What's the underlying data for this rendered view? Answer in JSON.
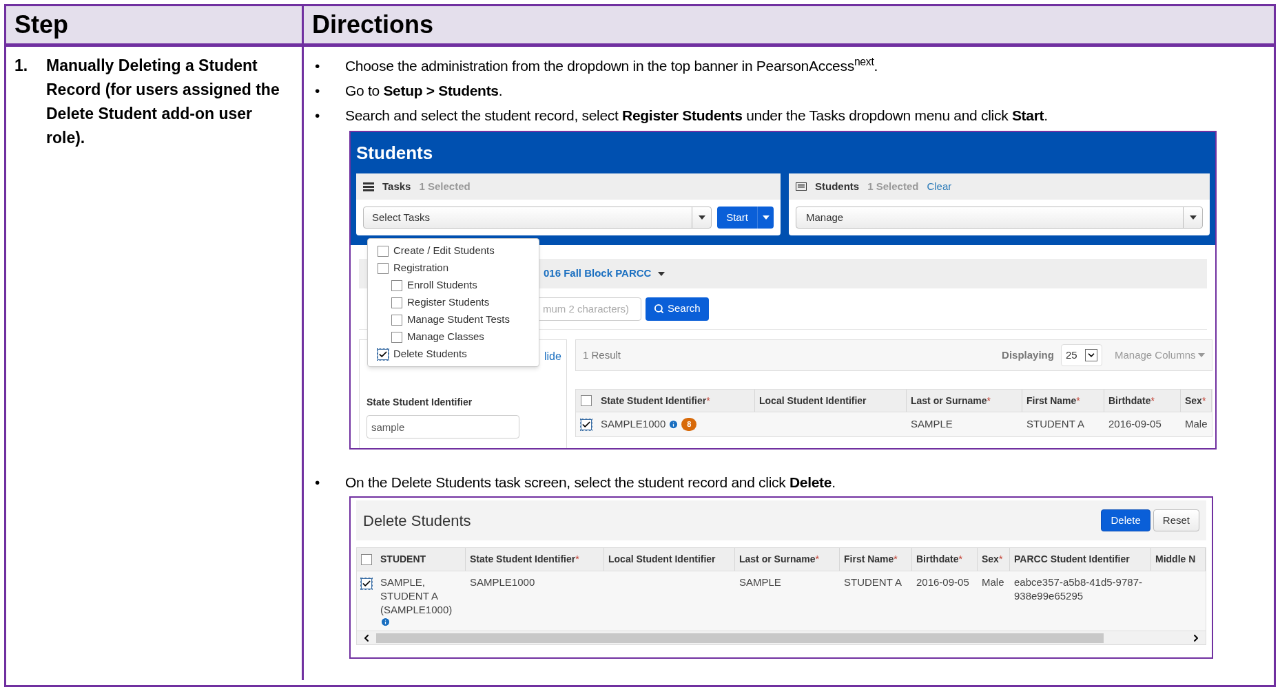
{
  "table": {
    "columns": [
      "Step",
      "Directions"
    ]
  },
  "rows": [
    {
      "step_number": "1.",
      "step_title": "Manually Deleting a Student Record (for users assigned the Delete Student add-on user role).",
      "directions": [
        {
          "kind": "bullet",
          "bullet": "•",
          "text": "Choose the administration from the dropdown in the top banner in PearsonAccess$^{next}$."
        },
        {
          "kind": "bullet",
          "bullet": "•",
          "text": "Go to **Setup > Students**."
        },
        {
          "kind": "bullet",
          "bullet": "•",
          "text": "Search and select the student record, select **Register Students** under the Tasks dropdown menu and click **Start**."
        },
        {
          "kind": "students_screen",
          "title": "Students",
          "tasks_panel": {
            "title": "Tasks",
            "count": "1 Selected",
            "select": "Select Tasks",
            "start_button": "Start"
          },
          "students_panel": {
            "title": "Students",
            "count": "1 Selected",
            "clear_link": "Clear",
            "select": "Manage"
          },
          "task_menu": [
            {
              "label": "Create / Edit Students",
              "checked": false
            },
            {
              "label": "Registration",
              "checked": false,
              "children": [
                {
                  "label": "Enroll Students",
                  "checked": false
                },
                {
                  "label": "Register Students",
                  "checked": false
                },
                {
                  "label": "Manage Student Tests",
                  "checked": false
                },
                {
                  "label": "Manage Classes",
                  "checked": false
                }
              ]
            },
            {
              "label": "Delete Students",
              "checked": true
            }
          ],
          "administration": "016 Fall Block PARCC",
          "search_placeholder": "mum 2 characters)",
          "search_button": "Search",
          "filter_panel": {
            "link": "lide",
            "field_label": "State Student Identifier",
            "field_value": "sample"
          },
          "results": {
            "count": "1 Result",
            "displaying_label": "Displaying",
            "page_size": "25",
            "manage_columns": "Manage Columns",
            "select_all": false,
            "columns": [
              {
                "label": "State Student Identifier",
                "mark": "*"
              },
              {
                "label": "Local Student Identifier"
              },
              {
                "label": "Last or Surname",
                "mark": "*"
              },
              {
                "label": "First Name",
                "mark": "*"
              },
              {
                "label": "Birthdate",
                "mark": "*"
              },
              {
                "label": "Sex",
                "mark": "*"
              }
            ],
            "rows": [
              {
                "selected": true,
                "state_id": "SAMPLE1000",
                "alerts": "8",
                "last_name": "SAMPLE",
                "first_name": "STUDENT A",
                "birthdate": "2016-09-05",
                "sex": "Male"
              }
            ]
          }
        },
        {
          "kind": "bullet",
          "bullet": "•",
          "text": "On the Delete Students task screen, select the student record and click **Delete**."
        },
        {
          "kind": "delete_screen",
          "title": "Delete Students",
          "buttons": [
            {
              "label": "Delete",
              "kind": "primary"
            },
            {
              "label": "Reset",
              "kind": "default"
            }
          ],
          "select_all": false,
          "columns": [
            {
              "label": "STUDENT"
            },
            {
              "label": "State Student Identifier",
              "mark": "*"
            },
            {
              "label": "Local Student Identifier"
            },
            {
              "label": "Last or Surname",
              "mark": "*"
            },
            {
              "label": "First Name",
              "mark": "*"
            },
            {
              "label": "Birthdate",
              "mark": "*"
            },
            {
              "label": "Sex",
              "mark": "*"
            },
            {
              "label": "PARCC Student Identifier"
            },
            {
              "label": "Middle N"
            }
          ],
          "rows": [
            {
              "selected": true,
              "student": "SAMPLE, STUDENT A (SAMPLE1000)",
              "state_id": "SAMPLE1000",
              "last_name": "SAMPLE",
              "first_name": "STUDENT A",
              "birthdate": "2016-09-05",
              "sex": "Male",
              "parcc_id": "eabce357-a5b8-41d5-9787-938e99e65295"
            }
          ]
        }
      ]
    }
  ]
}
